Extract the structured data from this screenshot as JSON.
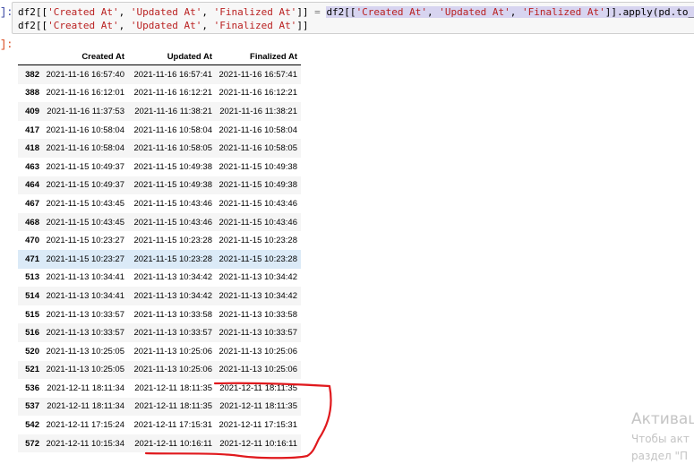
{
  "input_cell": {
    "prompt": "]:",
    "line1": {
      "lhs": "df2[[",
      "s1": "'Created At'",
      "sep1": ", ",
      "s2": "'Updated At'",
      "sep2": ", ",
      "s3": "'Finalized At'",
      "close1": "]]",
      "eq": " = ",
      "rhs_open": "df2[[",
      "r1": "'Created At'",
      "rsep1": ", ",
      "r2": "'Updated At'",
      "rsep2": ", ",
      "r3": "'Finalized At'",
      "rhs_tail": "]].apply(pd.to_datetime)"
    },
    "line2": {
      "open": "df2[[",
      "s1": "'Created At'",
      "sep1": ", ",
      "s2": "'Updated At'",
      "sep2": ", ",
      "s3": "'Finalized At'",
      "close": "]]"
    }
  },
  "output_cell": {
    "prompt": "]:"
  },
  "dataframe": {
    "columns": [
      "Created At",
      "Updated At",
      "Finalized At"
    ],
    "rows": [
      {
        "index": "382",
        "created": "2021-11-16 16:57:40",
        "updated": "2021-11-16 16:57:41",
        "finalized": "2021-11-16 16:57:41"
      },
      {
        "index": "388",
        "created": "2021-11-16 16:12:01",
        "updated": "2021-11-16 16:12:21",
        "finalized": "2021-11-16 16:12:21"
      },
      {
        "index": "409",
        "created": "2021-11-16 11:37:53",
        "updated": "2021-11-16 11:38:21",
        "finalized": "2021-11-16 11:38:21"
      },
      {
        "index": "417",
        "created": "2021-11-16 10:58:04",
        "updated": "2021-11-16 10:58:04",
        "finalized": "2021-11-16 10:58:04"
      },
      {
        "index": "418",
        "created": "2021-11-16 10:58:04",
        "updated": "2021-11-16 10:58:05",
        "finalized": "2021-11-16 10:58:05"
      },
      {
        "index": "463",
        "created": "2021-11-15 10:49:37",
        "updated": "2021-11-15 10:49:38",
        "finalized": "2021-11-15 10:49:38"
      },
      {
        "index": "464",
        "created": "2021-11-15 10:49:37",
        "updated": "2021-11-15 10:49:38",
        "finalized": "2021-11-15 10:49:38"
      },
      {
        "index": "467",
        "created": "2021-11-15 10:43:45",
        "updated": "2021-11-15 10:43:46",
        "finalized": "2021-11-15 10:43:46"
      },
      {
        "index": "468",
        "created": "2021-11-15 10:43:45",
        "updated": "2021-11-15 10:43:46",
        "finalized": "2021-11-15 10:43:46"
      },
      {
        "index": "470",
        "created": "2021-11-15 10:23:27",
        "updated": "2021-11-15 10:23:28",
        "finalized": "2021-11-15 10:23:28"
      },
      {
        "index": "471",
        "created": "2021-11-15 10:23:27",
        "updated": "2021-11-15 10:23:28",
        "finalized": "2021-11-15 10:23:28"
      },
      {
        "index": "513",
        "created": "2021-11-13 10:34:41",
        "updated": "2021-11-13 10:34:42",
        "finalized": "2021-11-13 10:34:42"
      },
      {
        "index": "514",
        "created": "2021-11-13 10:34:41",
        "updated": "2021-11-13 10:34:42",
        "finalized": "2021-11-13 10:34:42"
      },
      {
        "index": "515",
        "created": "2021-11-13 10:33:57",
        "updated": "2021-11-13 10:33:58",
        "finalized": "2021-11-13 10:33:58"
      },
      {
        "index": "516",
        "created": "2021-11-13 10:33:57",
        "updated": "2021-11-13 10:33:57",
        "finalized": "2021-11-13 10:33:57"
      },
      {
        "index": "520",
        "created": "2021-11-13 10:25:05",
        "updated": "2021-11-13 10:25:06",
        "finalized": "2021-11-13 10:25:06"
      },
      {
        "index": "521",
        "created": "2021-11-13 10:25:05",
        "updated": "2021-11-13 10:25:06",
        "finalized": "2021-11-13 10:25:06"
      },
      {
        "index": "536",
        "created": "2021-12-11 18:11:34",
        "updated": "2021-12-11 18:11:35",
        "finalized": "2021-12-11 18:11:35"
      },
      {
        "index": "537",
        "created": "2021-12-11 18:11:34",
        "updated": "2021-12-11 18:11:35",
        "finalized": "2021-12-11 18:11:35"
      },
      {
        "index": "542",
        "created": "2021-12-11 17:15:24",
        "updated": "2021-12-11 17:15:31",
        "finalized": "2021-12-11 17:15:31"
      },
      {
        "index": "572",
        "created": "2021-12-11 10:15:34",
        "updated": "2021-12-11 10:16:11",
        "finalized": "2021-12-11 10:16:11"
      }
    ],
    "hovered_row_index": "471"
  },
  "watermark": {
    "title": "Активац",
    "line1": "Чтобы акт",
    "line2": "раздел \"П"
  },
  "colors": {
    "annotation_red": "#e0191d",
    "string_token": "#ba2121",
    "selection": "#d7d4f0",
    "hover_row": "#dbeaf7"
  }
}
